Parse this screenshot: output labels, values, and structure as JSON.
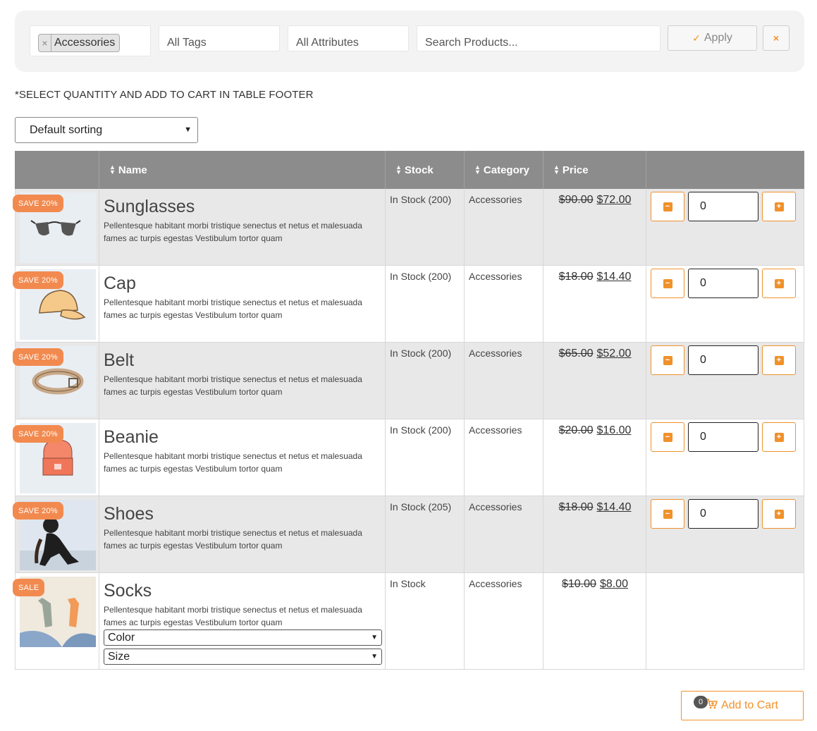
{
  "filters": {
    "category_chip": "Accessories",
    "chip_remove": "×",
    "tags_placeholder": "All Tags",
    "attributes_placeholder": "All Attributes",
    "search_placeholder": "Search Products...",
    "apply_label": "Apply",
    "clear_label": "×"
  },
  "note": "*SELECT QUANTITY AND ADD TO CART IN TABLE FOOTER",
  "sorting": {
    "selected": "Default sorting"
  },
  "table": {
    "headers": {
      "name": "Name",
      "stock": "Stock",
      "category": "Category",
      "price": "Price"
    },
    "rows": [
      {
        "badge": "SAVE 20%",
        "name": "Sunglasses",
        "desc": "Pellentesque habitant morbi tristique senectus et netus et malesuada fames ac turpis egestas Vestibulum tortor quam",
        "stock": "In Stock (200)",
        "category": "Accessories",
        "old_price": "$90.00",
        "new_price": "$72.00",
        "qty": "0",
        "icon": "sunglasses-image"
      },
      {
        "badge": "SAVE 20%",
        "name": "Cap",
        "desc": "Pellentesque habitant morbi tristique senectus et netus et malesuada fames ac turpis egestas Vestibulum tortor quam",
        "stock": "In Stock (200)",
        "category": "Accessories",
        "old_price": "$18.00",
        "new_price": "$14.40",
        "qty": "0",
        "icon": "cap-image"
      },
      {
        "badge": "SAVE 20%",
        "name": "Belt",
        "desc": "Pellentesque habitant morbi tristique senectus et netus et malesuada fames ac turpis egestas Vestibulum tortor quam",
        "stock": "In Stock (200)",
        "category": "Accessories",
        "old_price": "$65.00",
        "new_price": "$52.00",
        "qty": "0",
        "icon": "belt-image"
      },
      {
        "badge": "SAVE 20%",
        "name": "Beanie",
        "desc": "Pellentesque habitant morbi tristique senectus et netus et malesuada fames ac turpis egestas Vestibulum tortor quam",
        "stock": "In Stock (200)",
        "category": "Accessories",
        "old_price": "$20.00",
        "new_price": "$16.00",
        "qty": "0",
        "icon": "beanie-image"
      },
      {
        "badge": "SAVE 20%",
        "name": "Shoes",
        "desc": "Pellentesque habitant morbi tristique senectus et netus et malesuada fames ac turpis egestas Vestibulum tortor quam",
        "stock": "In Stock (205)",
        "category": "Accessories",
        "old_price": "$18.00",
        "new_price": "$14.40",
        "qty": "0",
        "icon": "shoes-image"
      },
      {
        "badge": "SALE",
        "name": "Socks",
        "desc": "Pellentesque habitant morbi tristique senectus et netus et malesuada fames ac turpis egestas Vestibulum tortor quam",
        "stock": "In Stock",
        "category": "Accessories",
        "old_price": "$10.00",
        "new_price": "$8.00",
        "color_select": "Color",
        "size_select": "Size",
        "icon": "socks-image"
      }
    ]
  },
  "cart": {
    "count": "0",
    "label": "Add to Cart"
  },
  "colors": {
    "accent": "#f0912b",
    "badge": "#f28a4f",
    "header_bg": "#8c8c8c",
    "alt_row": "#e8e8e8"
  }
}
